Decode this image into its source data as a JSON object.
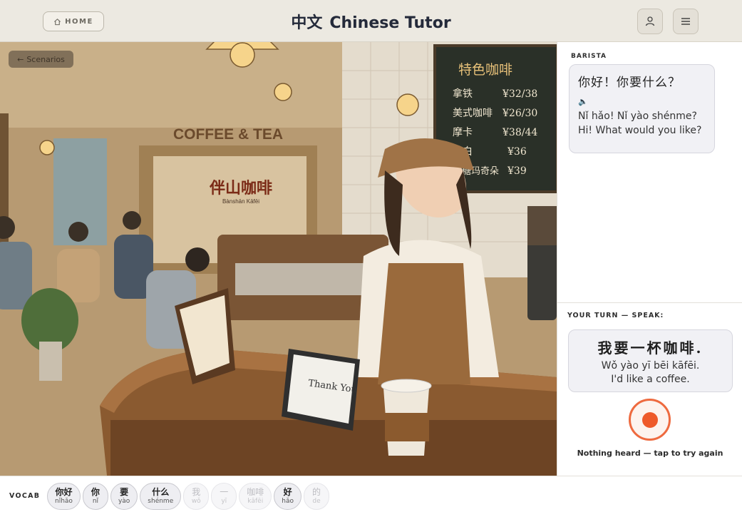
{
  "header": {
    "home_label": "HOME",
    "title_hanzi": "中文",
    "title_text": "Chinese Tutor"
  },
  "scene": {
    "back_label": "Scenarios",
    "back_icon": "arrow-left-icon",
    "sign_coffee_tea": "COFFEE & TEA",
    "shop_name_zh": "伴山咖啡",
    "shop_name_pinyin": "Bànshān Kāfēi",
    "menu_board_title": "特色咖啡",
    "menu_items": [
      {
        "name": "拿铁",
        "price": "¥32/38"
      },
      {
        "name": "美式咖啡",
        "price": "¥26/30"
      },
      {
        "name": "摩卡",
        "price": "¥38/44"
      },
      {
        "name": "馥白",
        "price": "¥36"
      },
      {
        "name": "焦糖玛奇朵",
        "price": "¥39"
      }
    ],
    "tablet_text": "Thank You"
  },
  "dialogue": {
    "speaker": "BARISTA",
    "zh": "你好！你要什么？",
    "audio_icon": "speaker-icon",
    "pinyin": "Nǐ hǎo! Nǐ yào shénme?",
    "en": "Hi! What would you like?"
  },
  "your_turn": {
    "label": "YOUR TURN — SPEAK:",
    "zh": "我要一杯咖啡.",
    "pinyin": "Wǒ yào yī bēi kāfēi.",
    "en": "I'd like a coffee.",
    "status": "Nothing heard — tap to try again"
  },
  "vocab": {
    "label": "VOCAB",
    "chips": [
      {
        "zh": "你好",
        "pinyin": "nǐhǎo",
        "learned": true
      },
      {
        "zh": "你",
        "pinyin": "nǐ",
        "learned": true
      },
      {
        "zh": "要",
        "pinyin": "yào",
        "learned": true
      },
      {
        "zh": "什么",
        "pinyin": "shénme",
        "learned": true
      },
      {
        "zh": "我",
        "pinyin": "wǒ",
        "learned": false
      },
      {
        "zh": "一",
        "pinyin": "yī",
        "learned": false
      },
      {
        "zh": "咖啡",
        "pinyin": "kāfēi",
        "learned": false
      },
      {
        "zh": "好",
        "pinyin": "hǎo",
        "learned": true
      },
      {
        "zh": "的",
        "pinyin": "de",
        "learned": false
      }
    ]
  },
  "colors": {
    "header_bg": "#ece9e1",
    "record_accent": "#ee5a2a",
    "chalkboard": "#2a3028"
  }
}
